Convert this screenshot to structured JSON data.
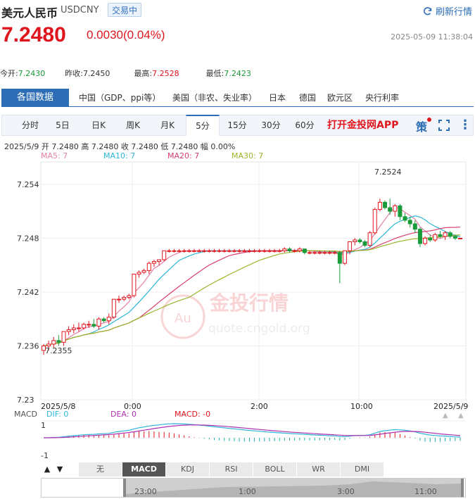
{
  "header": {
    "name": "美元人民币",
    "code": "USDCNY",
    "status": "交易中",
    "refresh_label": "刷新行情"
  },
  "quote": {
    "price": "7.2480",
    "change": "0.0030(0.04%)",
    "timestamp": "2025-05-09 11:38:04"
  },
  "stats": [
    {
      "label": "今开:",
      "value": "7.2430",
      "color": "green"
    },
    {
      "label": "昨收:",
      "value": "7.2450",
      "color": "plain"
    },
    {
      "label": "最高:",
      "value": "7.2528",
      "color": "red"
    },
    {
      "label": "最低:",
      "value": "7.2423",
      "color": "green"
    }
  ],
  "data_tabs": {
    "active": "各国数据",
    "items": [
      "中国（GDP、ppi等）",
      "美国（非农、失业率）",
      "日本",
      "德国",
      "欧元区",
      "央行利率"
    ]
  },
  "periods": {
    "items": [
      "分时",
      "5日",
      "日K",
      "周K",
      "月K",
      "5分",
      "15分",
      "30分",
      "60分"
    ],
    "active_index": 5,
    "app_link": "打开金投网APP",
    "strategy_icon": "策"
  },
  "candle_info": "2025/5/9  开 7.2480  高 7.2480  收 7.2480  低 7.2480  幅 0.00%",
  "ma_legend": [
    {
      "label": "MA5: 7",
      "color": "#e87fa8"
    },
    {
      "label": "MA10: 7",
      "color": "#2eb6d8"
    },
    {
      "label": "MA20: 7",
      "color": "#d9406e"
    },
    {
      "label": "MA30: 7",
      "color": "#9ab62b"
    }
  ],
  "watermark": {
    "cn": "金投行情",
    "url": "quote.cngold.org",
    "logo": "Au"
  },
  "chart_data": {
    "type": "candlestick",
    "y_ticks": [
      "7.254",
      "7.248",
      "7.242",
      "7.236",
      "7.23"
    ],
    "ylim": [
      7.23,
      7.2565
    ],
    "x_labels": [
      "2025/5/8",
      "0:00",
      "2:00",
      "10:00",
      "2025/5/9"
    ],
    "annotations": {
      "high": "7.2524",
      "low": "7.2355"
    },
    "candles": [
      {
        "o": 7.2355,
        "h": 7.2362,
        "l": 7.235,
        "c": 7.236
      },
      {
        "o": 7.236,
        "h": 7.2366,
        "l": 7.2355,
        "c": 7.2362
      },
      {
        "o": 7.2362,
        "h": 7.237,
        "l": 7.2358,
        "c": 7.2366
      },
      {
        "o": 7.2366,
        "h": 7.2372,
        "l": 7.236,
        "c": 7.2364
      },
      {
        "o": 7.2364,
        "h": 7.2376,
        "l": 7.236,
        "c": 7.2376
      },
      {
        "o": 7.2376,
        "h": 7.2382,
        "l": 7.2372,
        "c": 7.2378
      },
      {
        "o": 7.2378,
        "h": 7.2384,
        "l": 7.2374,
        "c": 7.238
      },
      {
        "o": 7.238,
        "h": 7.2386,
        "l": 7.2376,
        "c": 7.238
      },
      {
        "o": 7.238,
        "h": 7.2386,
        "l": 7.2378,
        "c": 7.2384
      },
      {
        "o": 7.2384,
        "h": 7.2388,
        "l": 7.238,
        "c": 7.2384
      },
      {
        "o": 7.2384,
        "h": 7.239,
        "l": 7.238,
        "c": 7.2382
      },
      {
        "o": 7.2382,
        "h": 7.2392,
        "l": 7.2378,
        "c": 7.239
      },
      {
        "o": 7.239,
        "h": 7.2392,
        "l": 7.2386,
        "c": 7.2388
      },
      {
        "o": 7.2388,
        "h": 7.2396,
        "l": 7.2384,
        "c": 7.2392
      },
      {
        "o": 7.2392,
        "h": 7.2412,
        "l": 7.239,
        "c": 7.2412
      },
      {
        "o": 7.2412,
        "h": 7.2416,
        "l": 7.2408,
        "c": 7.2412
      },
      {
        "o": 7.2412,
        "h": 7.2416,
        "l": 7.241,
        "c": 7.2414
      },
      {
        "o": 7.2414,
        "h": 7.2418,
        "l": 7.2412,
        "c": 7.2416
      },
      {
        "o": 7.2416,
        "h": 7.244,
        "l": 7.2414,
        "c": 7.244
      },
      {
        "o": 7.244,
        "h": 7.2444,
        "l": 7.2436,
        "c": 7.2442
      },
      {
        "o": 7.2442,
        "h": 7.2446,
        "l": 7.244,
        "c": 7.2444
      },
      {
        "o": 7.2444,
        "h": 7.2454,
        "l": 7.244,
        "c": 7.2452
      },
      {
        "o": 7.2452,
        "h": 7.2456,
        "l": 7.2448,
        "c": 7.2454
      },
      {
        "o": 7.2454,
        "h": 7.2456,
        "l": 7.245,
        "c": 7.2456
      },
      {
        "o": 7.2456,
        "h": 7.2466,
        "l": 7.2454,
        "c": 7.2466
      },
      {
        "o": 7.2466,
        "h": 7.2468,
        "l": 7.2464,
        "c": 7.2466
      },
      {
        "o": 7.2466,
        "h": 7.2468,
        "l": 7.2464,
        "c": 7.2466
      },
      {
        "o": 7.2466,
        "h": 7.2468,
        "l": 7.2464,
        "c": 7.2466
      },
      {
        "o": 7.2466,
        "h": 7.2468,
        "l": 7.2464,
        "c": 7.2466
      },
      {
        "o": 7.2466,
        "h": 7.2468,
        "l": 7.2464,
        "c": 7.2466
      },
      {
        "o": 7.2466,
        "h": 7.2468,
        "l": 7.2464,
        "c": 7.2466
      },
      {
        "o": 7.2466,
        "h": 7.2468,
        "l": 7.2464,
        "c": 7.2466
      },
      {
        "o": 7.2466,
        "h": 7.2468,
        "l": 7.2464,
        "c": 7.2466
      },
      {
        "o": 7.2466,
        "h": 7.2468,
        "l": 7.2464,
        "c": 7.2466
      },
      {
        "o": 7.2466,
        "h": 7.2468,
        "l": 7.2464,
        "c": 7.2466
      },
      {
        "o": 7.2466,
        "h": 7.2468,
        "l": 7.2464,
        "c": 7.2466
      },
      {
        "o": 7.2466,
        "h": 7.2468,
        "l": 7.2464,
        "c": 7.2466
      },
      {
        "o": 7.2466,
        "h": 7.2468,
        "l": 7.2464,
        "c": 7.2466
      },
      {
        "o": 7.2466,
        "h": 7.2468,
        "l": 7.2464,
        "c": 7.2466
      },
      {
        "o": 7.2466,
        "h": 7.2468,
        "l": 7.2464,
        "c": 7.2466
      },
      {
        "o": 7.2466,
        "h": 7.2468,
        "l": 7.2464,
        "c": 7.2466
      },
      {
        "o": 7.2466,
        "h": 7.2468,
        "l": 7.2464,
        "c": 7.2466
      },
      {
        "o": 7.2466,
        "h": 7.2468,
        "l": 7.2464,
        "c": 7.2466
      },
      {
        "o": 7.2466,
        "h": 7.2468,
        "l": 7.2464,
        "c": 7.2466
      },
      {
        "o": 7.2466,
        "h": 7.2468,
        "l": 7.2464,
        "c": 7.2466
      },
      {
        "o": 7.2466,
        "h": 7.2468,
        "l": 7.2464,
        "c": 7.2466
      },
      {
        "o": 7.2466,
        "h": 7.2468,
        "l": 7.2464,
        "c": 7.2466
      },
      {
        "o": 7.2466,
        "h": 7.2468,
        "l": 7.2464,
        "c": 7.2466
      },
      {
        "o": 7.2466,
        "h": 7.247,
        "l": 7.2464,
        "c": 7.2468
      },
      {
        "o": 7.2468,
        "h": 7.247,
        "l": 7.2464,
        "c": 7.2466
      },
      {
        "o": 7.2466,
        "h": 7.2468,
        "l": 7.2464,
        "c": 7.2466
      },
      {
        "o": 7.2466,
        "h": 7.247,
        "l": 7.2464,
        "c": 7.2468
      },
      {
        "o": 7.2468,
        "h": 7.2468,
        "l": 7.2462,
        "c": 7.2464
      },
      {
        "o": 7.2464,
        "h": 7.2466,
        "l": 7.2462,
        "c": 7.2464
      },
      {
        "o": 7.2464,
        "h": 7.2466,
        "l": 7.2462,
        "c": 7.2464
      },
      {
        "o": 7.2464,
        "h": 7.2466,
        "l": 7.2462,
        "c": 7.2464
      },
      {
        "o": 7.2464,
        "h": 7.2466,
        "l": 7.2462,
        "c": 7.2464
      },
      {
        "o": 7.2464,
        "h": 7.2466,
        "l": 7.2462,
        "c": 7.2464
      },
      {
        "o": 7.2464,
        "h": 7.2466,
        "l": 7.2462,
        "c": 7.2464
      },
      {
        "o": 7.2464,
        "h": 7.2466,
        "l": 7.243,
        "c": 7.2452
      },
      {
        "o": 7.2452,
        "h": 7.2466,
        "l": 7.245,
        "c": 7.2466
      },
      {
        "o": 7.2466,
        "h": 7.2476,
        "l": 7.2462,
        "c": 7.2476
      },
      {
        "o": 7.2476,
        "h": 7.248,
        "l": 7.2472,
        "c": 7.2478
      },
      {
        "o": 7.2478,
        "h": 7.248,
        "l": 7.2474,
        "c": 7.2476
      },
      {
        "o": 7.2476,
        "h": 7.2478,
        "l": 7.247,
        "c": 7.2472
      },
      {
        "o": 7.2472,
        "h": 7.2488,
        "l": 7.247,
        "c": 7.2486
      },
      {
        "o": 7.2486,
        "h": 7.2514,
        "l": 7.2484,
        "c": 7.2512
      },
      {
        "o": 7.2512,
        "h": 7.2524,
        "l": 7.251,
        "c": 7.252
      },
      {
        "o": 7.252,
        "h": 7.2522,
        "l": 7.2512,
        "c": 7.2514
      },
      {
        "o": 7.2514,
        "h": 7.2524,
        "l": 7.2506,
        "c": 7.251
      },
      {
        "o": 7.251,
        "h": 7.2518,
        "l": 7.2504,
        "c": 7.2516
      },
      {
        "o": 7.2516,
        "h": 7.2518,
        "l": 7.25,
        "c": 7.2504
      },
      {
        "o": 7.2504,
        "h": 7.2508,
        "l": 7.2498,
        "c": 7.25
      },
      {
        "o": 7.25,
        "h": 7.2504,
        "l": 7.2492,
        "c": 7.2496
      },
      {
        "o": 7.2496,
        "h": 7.25,
        "l": 7.2486,
        "c": 7.249
      },
      {
        "o": 7.249,
        "h": 7.2492,
        "l": 7.247,
        "c": 7.2474
      },
      {
        "o": 7.2474,
        "h": 7.2482,
        "l": 7.2472,
        "c": 7.248
      },
      {
        "o": 7.248,
        "h": 7.2484,
        "l": 7.2476,
        "c": 7.2478
      },
      {
        "o": 7.2478,
        "h": 7.2486,
        "l": 7.2476,
        "c": 7.2484
      },
      {
        "o": 7.2484,
        "h": 7.2488,
        "l": 7.248,
        "c": 7.2482
      },
      {
        "o": 7.2482,
        "h": 7.2488,
        "l": 7.2478,
        "c": 7.2486
      },
      {
        "o": 7.2486,
        "h": 7.2488,
        "l": 7.248,
        "c": 7.2482
      },
      {
        "o": 7.2482,
        "h": 7.2484,
        "l": 7.2478,
        "c": 7.248
      },
      {
        "o": 7.248,
        "h": 7.248,
        "l": 7.248,
        "c": 7.248
      }
    ]
  },
  "macd": {
    "label": "MACD",
    "dif": "DIF: 0",
    "dea": "DEA: 0",
    "macd": "MACD: -0",
    "y_top": "1",
    "y_bottom": "-1",
    "dif_color": "#2eb6d8",
    "dea_color": "#b02fb0"
  },
  "indicators": {
    "arrows": [
      "▲",
      "▼"
    ],
    "items": [
      "无",
      "MACD",
      "KDJ",
      "RSI",
      "BOLL",
      "WR",
      "DMI"
    ],
    "active_index": 1
  },
  "navigator": {
    "labels": [
      "23:00",
      "1:00",
      "3:00",
      "11:00"
    ]
  }
}
